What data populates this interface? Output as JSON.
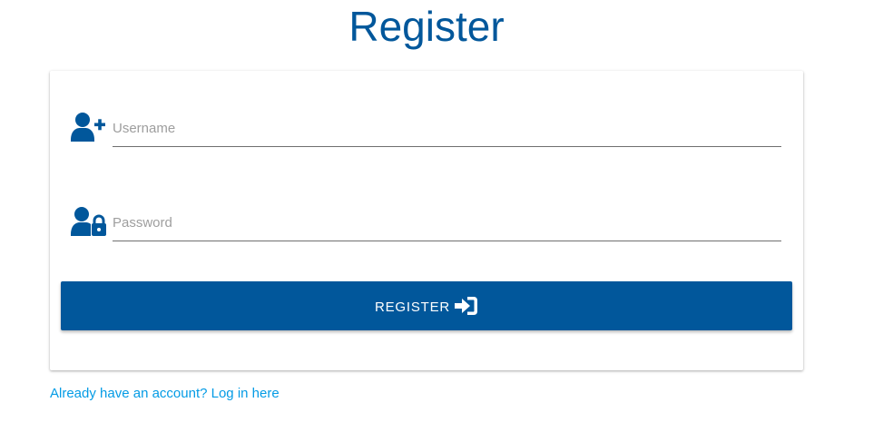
{
  "header": {
    "title": "Register"
  },
  "form": {
    "username": {
      "placeholder": "Username",
      "value": "",
      "icon": "user-plus-icon"
    },
    "password": {
      "placeholder": "Password",
      "value": "",
      "icon": "user-lock-icon"
    },
    "submit": {
      "label": "Register",
      "icon": "sign-in-icon"
    }
  },
  "footer": {
    "login_link": "Already have an account? Log in here"
  },
  "colors": {
    "primary": "#01579b",
    "link": "#039be5",
    "placeholder": "#9e9e9e"
  }
}
